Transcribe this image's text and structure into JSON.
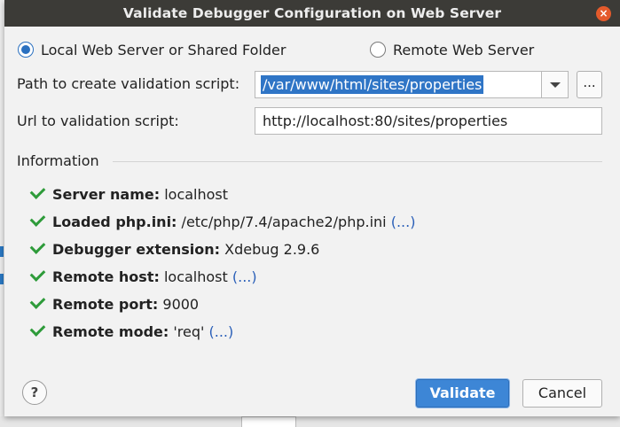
{
  "dialog": {
    "title": "Validate Debugger Configuration on Web Server",
    "close_glyph": "×"
  },
  "options": {
    "local_label": "Local Web Server or Shared Folder",
    "remote_label": "Remote Web Server",
    "selected": "local"
  },
  "path": {
    "label": "Path to create validation script:",
    "value": "/var/www/html/sites/properties",
    "browse_label": "..."
  },
  "url": {
    "label": "Url to validation script:",
    "value": "http://localhost:80/sites/properties"
  },
  "information": {
    "heading": "Information",
    "items": [
      {
        "key": "Server name:",
        "value": "localhost",
        "more": ""
      },
      {
        "key": "Loaded php.ini:",
        "value": "/etc/php/7.4/apache2/php.ini",
        "more": "(...)"
      },
      {
        "key": "Debugger extension:",
        "value": "Xdebug 2.9.6",
        "more": ""
      },
      {
        "key": "Remote host:",
        "value": "localhost",
        "more": "(...)"
      },
      {
        "key": "Remote port:",
        "value": "9000",
        "more": ""
      },
      {
        "key": "Remote mode:",
        "value": "'req'",
        "more": "(...)"
      }
    ]
  },
  "footer": {
    "help_label": "?",
    "validate_label": "Validate",
    "cancel_label": "Cancel"
  },
  "colors": {
    "accent": "#3d86d6",
    "check": "#2e9b3a",
    "titlebar": "#3c3b37",
    "close": "#e45a2b"
  }
}
